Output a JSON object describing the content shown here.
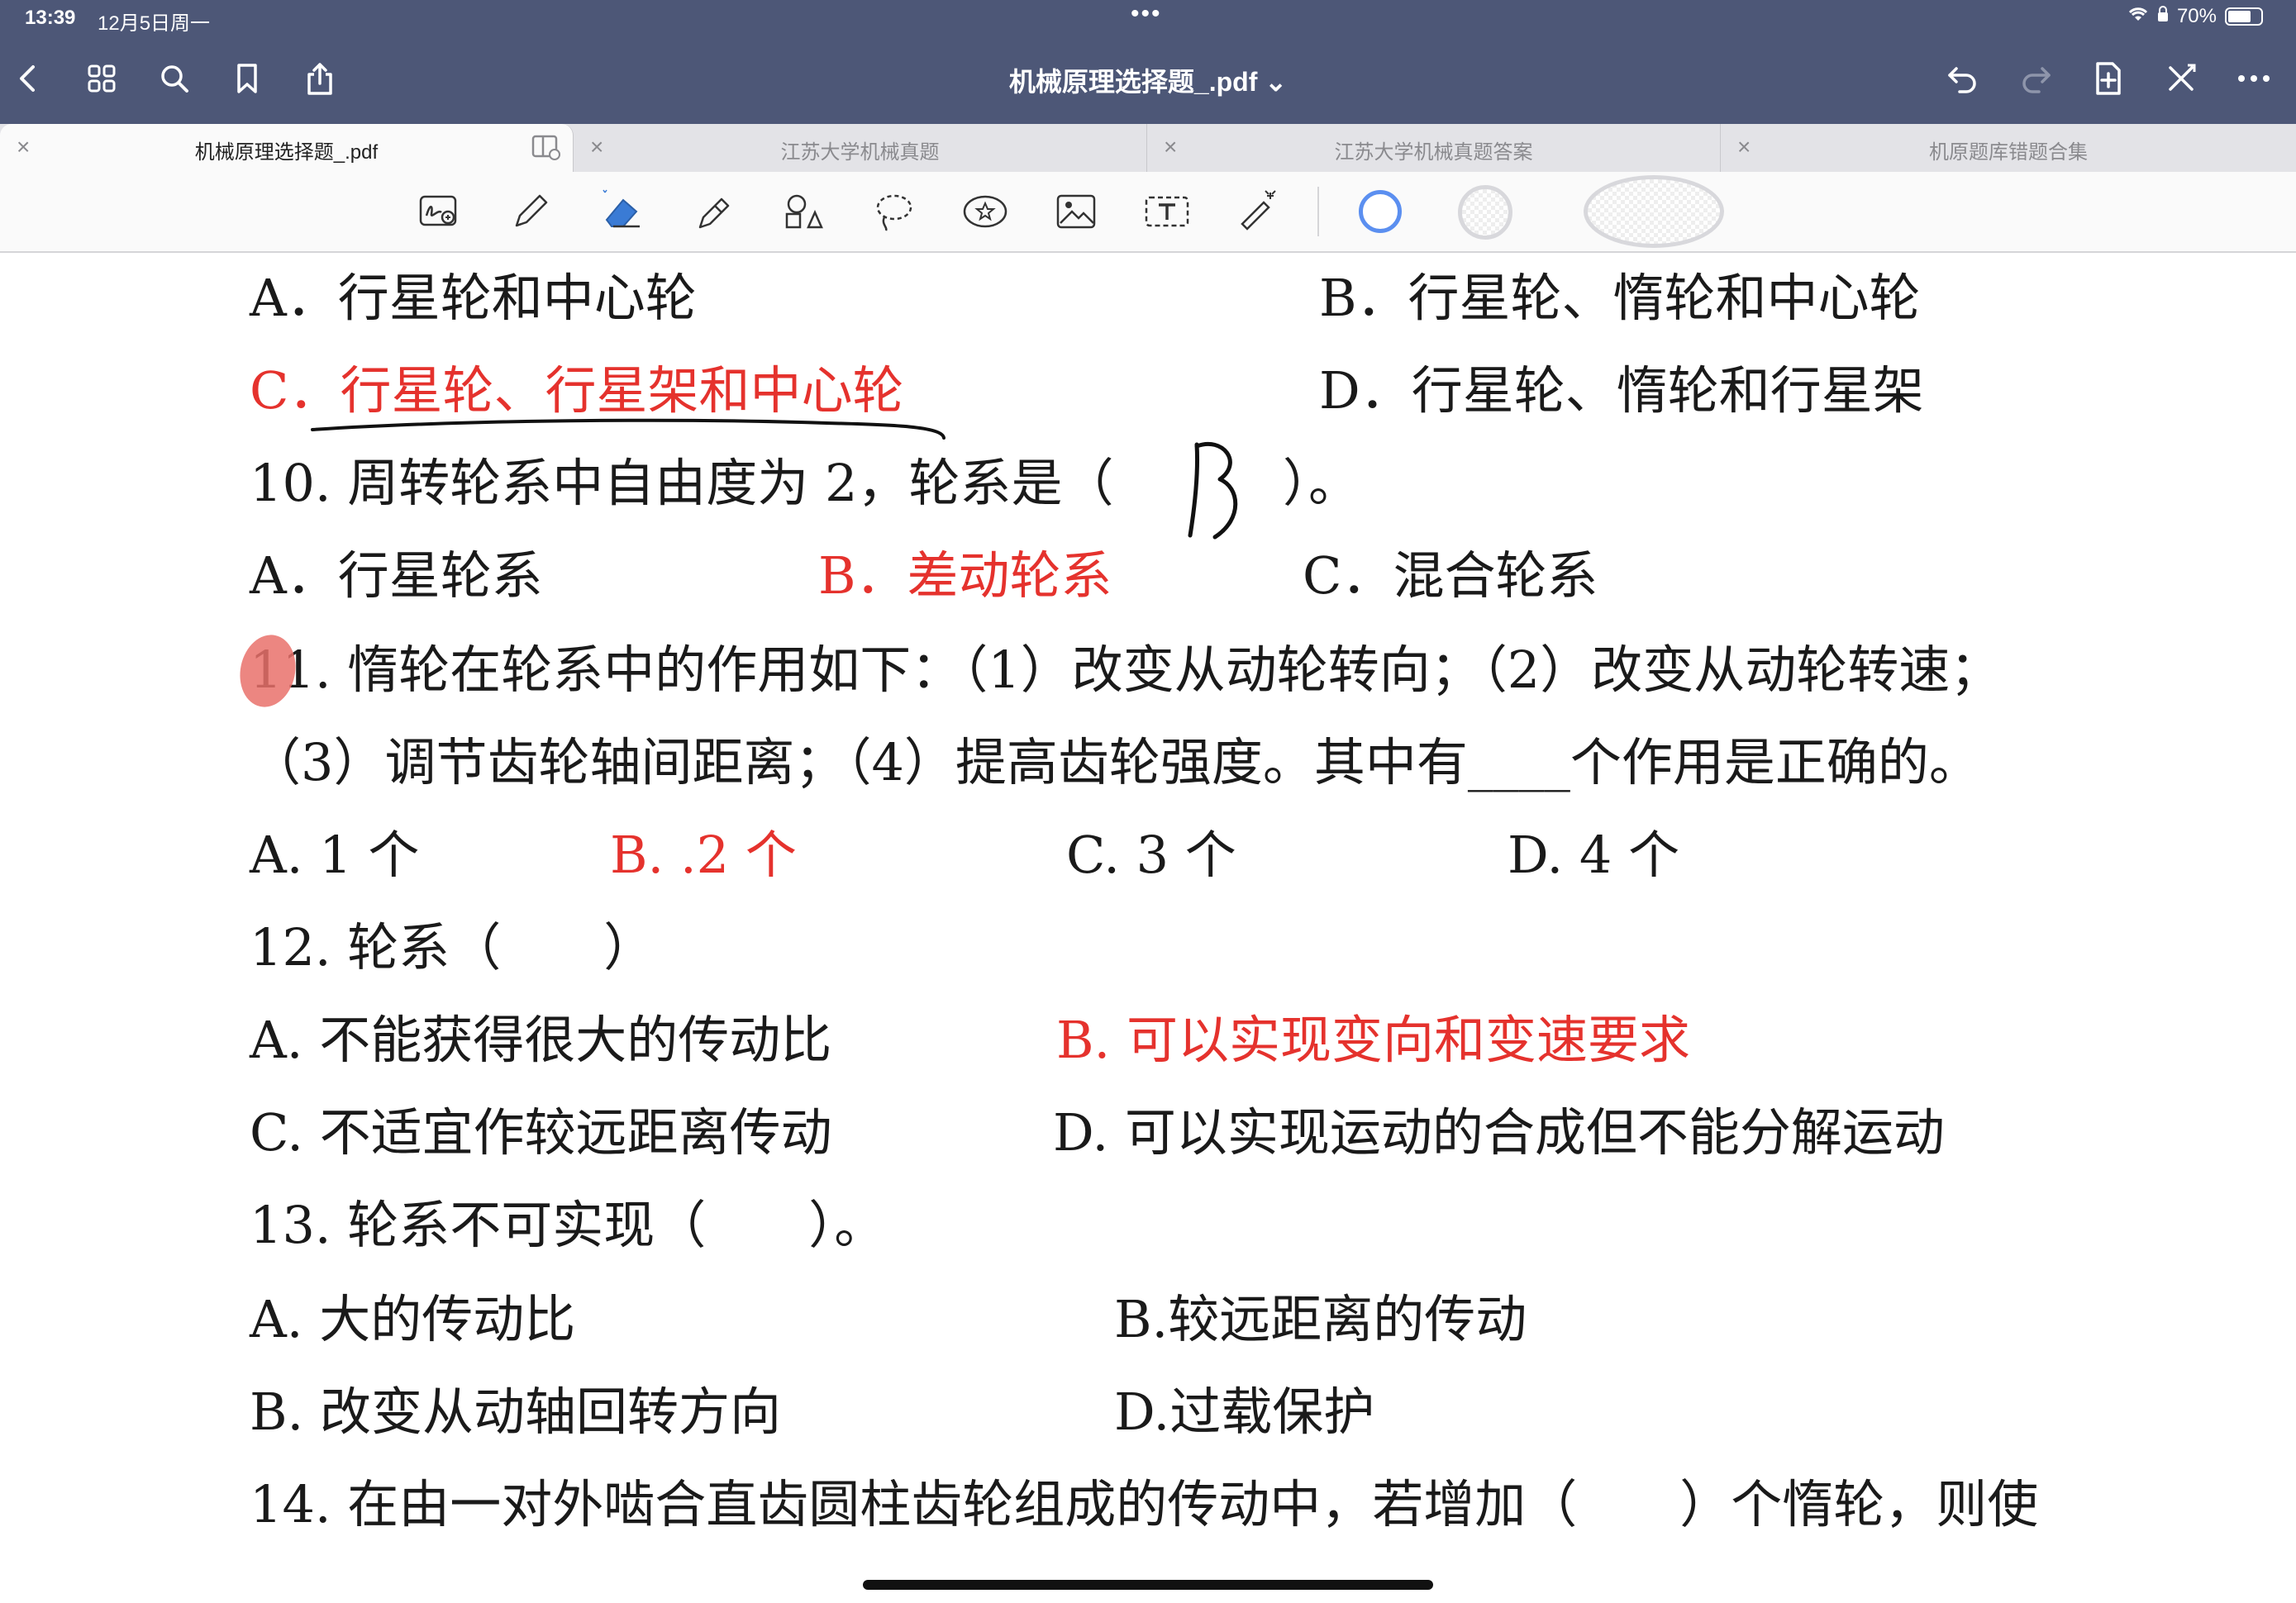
{
  "status_bar": {
    "time": "13:39",
    "date": "12月5日周一",
    "dots": "•••",
    "battery": "70%",
    "battery_level": 0.7
  },
  "nav": {
    "title": "机械原理选择题_.pdf ⌄",
    "left_icons": [
      "back-icon",
      "grid-icon",
      "search-icon",
      "bookmark-icon",
      "share-icon"
    ],
    "right_icons": [
      "undo-icon",
      "redo-icon",
      "add-page-icon",
      "close-pen-icon",
      "more-icon"
    ]
  },
  "tabs": [
    {
      "label": "机械原理选择题_.pdf",
      "close": "×",
      "active": true
    },
    {
      "label": "江苏大学机械真题",
      "close": "×",
      "active": false
    },
    {
      "label": "江苏大学机械真题答案",
      "close": "×",
      "active": false
    },
    {
      "label": "机原题库错题合集",
      "close": "×",
      "active": false
    }
  ],
  "toolbar": {
    "tools": [
      "handwriting-zoom-icon",
      "pen-icon",
      "eraser-icon",
      "highlighter-icon",
      "shapes-icon",
      "lasso-icon",
      "sticker-icon",
      "image-icon",
      "text-icon",
      "laser-pointer-icon"
    ],
    "colors": [
      "#5b8ff0"
    ]
  },
  "document": {
    "lines": [
      {
        "text": "A．行星轮和中心轮",
        "color": "black"
      },
      {
        "text": "B．行星轮、惰轮和中心轮",
        "color": "black"
      },
      {
        "text": "C．行星轮、行星架和中心轮",
        "color": "red"
      },
      {
        "text": "D．行星轮、惰轮和行星架",
        "color": "black"
      },
      {
        "text": "10. 周转轮系中自由度为 2，轮系是（",
        "color": "black"
      },
      {
        "text": "）。",
        "color": "black"
      },
      {
        "text": "A．行星轮系",
        "color": "black"
      },
      {
        "text": "B．差动轮系",
        "color": "red"
      },
      {
        "text": "C．混合轮系",
        "color": "black"
      },
      {
        "text": "11. 惰轮在轮系中的作用如下：（1）改变从动轮转向；（2）改变从动轮转速；",
        "color": "black"
      },
      {
        "text": "（3）调节齿轮轴间距离；（4）提高齿轮强度。其中有____个作用是正确的。",
        "color": "black"
      },
      {
        "text": "A. 1 个",
        "color": "black"
      },
      {
        "text": "B. .2 个",
        "color": "red"
      },
      {
        "text": "C. 3 个",
        "color": "black"
      },
      {
        "text": "D. 4 个",
        "color": "black"
      },
      {
        "text": "12. 轮系（　　）",
        "color": "black"
      },
      {
        "text": "A. 不能获得很大的传动比",
        "color": "black"
      },
      {
        "text": "B. 可以实现变向和变速要求",
        "color": "red"
      },
      {
        "text": "C. 不适宜作较远距离传动",
        "color": "black"
      },
      {
        "text": "D. 可以实现运动的合成但不能分解运动",
        "color": "black"
      },
      {
        "text": "13. 轮系不可实现（　　）。",
        "color": "black"
      },
      {
        "text": "A. 大的传动比",
        "color": "black"
      },
      {
        "text": "B.较远距离的传动",
        "color": "black"
      },
      {
        "text": "B. 改变从动轴回转方向",
        "color": "black"
      },
      {
        "text": "D.过载保护",
        "color": "black"
      },
      {
        "text": "14. 在由一对外啮合直齿圆柱齿轮组成的传动中，若增加（　　）个惰轮，则使",
        "color": "black"
      }
    ],
    "annotation_colors": {
      "ink": "#111111",
      "highlight": "#e9716b",
      "answer_red": "#e5322d"
    }
  }
}
